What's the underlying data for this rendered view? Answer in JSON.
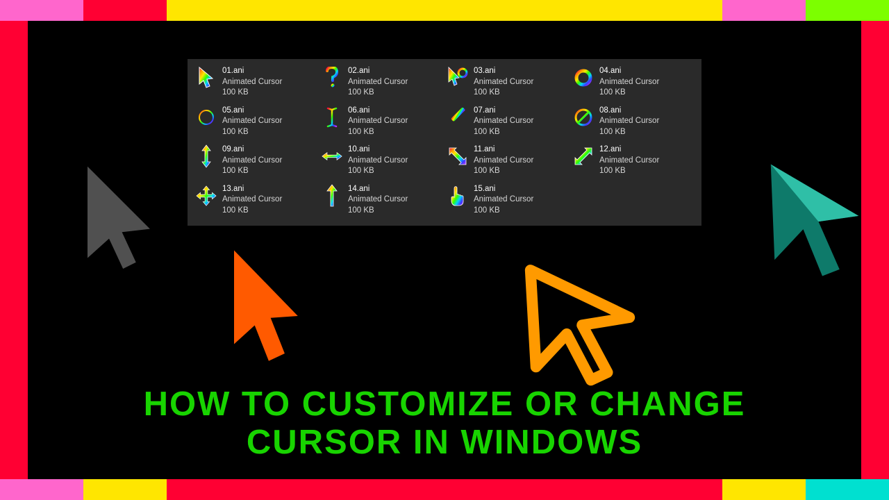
{
  "headline_line1": "How to Customize or Change",
  "headline_line2": "Cursor in Windows",
  "file_type_label": "Animated Cursor",
  "file_size_label": "100 KB",
  "files": [
    {
      "name": "01.ani",
      "icon": "pointer"
    },
    {
      "name": "02.ani",
      "icon": "help"
    },
    {
      "name": "03.ani",
      "icon": "busy-pointer"
    },
    {
      "name": "04.ani",
      "icon": "busy-ring"
    },
    {
      "name": "05.ani",
      "icon": "precision"
    },
    {
      "name": "06.ani",
      "icon": "text-beam"
    },
    {
      "name": "07.ani",
      "icon": "pen"
    },
    {
      "name": "08.ani",
      "icon": "unavailable"
    },
    {
      "name": "09.ani",
      "icon": "resize-ns"
    },
    {
      "name": "10.ani",
      "icon": "resize-ew"
    },
    {
      "name": "11.ani",
      "icon": "resize-nwse"
    },
    {
      "name": "12.ani",
      "icon": "resize-nesw"
    },
    {
      "name": "13.ani",
      "icon": "move"
    },
    {
      "name": "14.ani",
      "icon": "alt-select"
    },
    {
      "name": "15.ani",
      "icon": "link-hand"
    }
  ],
  "colors": {
    "headline": "#18d400",
    "panel_bg": "#2a2a2a",
    "rainbow": [
      "#ff0040",
      "#ff9900",
      "#ffe600",
      "#33ff00",
      "#00d0ff",
      "#3a3aff",
      "#c030ff"
    ]
  }
}
